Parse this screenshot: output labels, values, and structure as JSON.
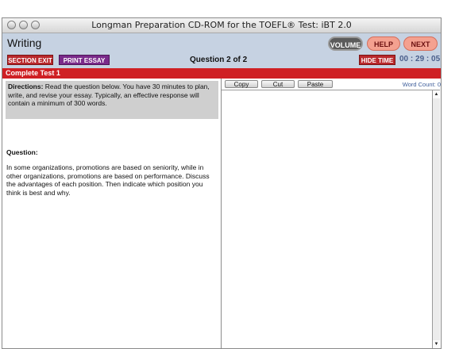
{
  "window": {
    "title": "Longman Preparation CD-ROM for the TOEFL® Test: iBT 2.0"
  },
  "header": {
    "app_title": "Writing",
    "volume_label": "VOLUME",
    "help_label": "HELP",
    "next_label": "NEXT",
    "section_exit_label": "SECTION EXIT",
    "print_essay_label": "PRINT ESSAY",
    "question_number": "Question 2 of 2",
    "hide_time_label": "HIDE TIME",
    "timer": "00 : 29 : 05"
  },
  "banner": {
    "label": "Complete Test 1"
  },
  "left": {
    "directions_label": "Directions:",
    "directions_text": " Read the question below. You have 30 minutes to plan, write, and revise your essay. Typically, an effective response will contain a minimum of 300 words.",
    "question_label": "Question:",
    "question_text": "In some organizations, promotions are based on seniority, while in other organizations, promotions are based on performance. Discuss the advantages of each position. Then indicate which position you think is best and why."
  },
  "editor": {
    "copy_label": "Copy",
    "cut_label": "Cut",
    "paste_label": "Paste",
    "word_count": "Word Count: 0"
  },
  "colors": {
    "accent_red": "#cf2024",
    "header_bg": "#c6d2e2",
    "purple": "#7a2a8a"
  }
}
